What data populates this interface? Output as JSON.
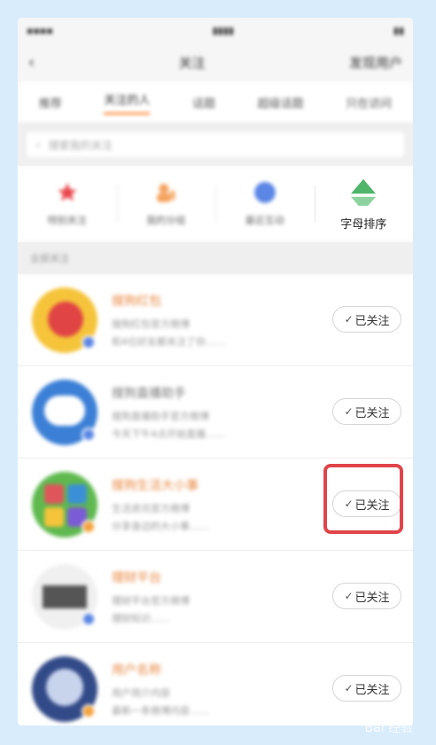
{
  "nav": {
    "title": "关注",
    "right_action": "发现用户"
  },
  "tabs": [
    "推荐",
    "关注的人",
    "话题",
    "超级话题",
    "只在访问"
  ],
  "search": {
    "placeholder": "搜索我的关注"
  },
  "filters": [
    {
      "label": "特别关注",
      "icon": "star-icon",
      "color": "#e8454b"
    },
    {
      "label": "我的分组",
      "icon": "group-icon",
      "color": "#f5a25d"
    },
    {
      "label": "最近互动",
      "icon": "compass-icon",
      "color": "#5b86e5"
    },
    {
      "label": "字母排序",
      "icon": "diamond-icon",
      "color": "#5cb85c"
    }
  ],
  "section_title": "全部关注",
  "follow_label": "已关注",
  "follow_check": "✓",
  "users": [
    {
      "name": "搜狗红包",
      "line1": "搜狗红包官方微博",
      "line2": "和4位好友都关注了你……",
      "name_color": "#e8843c",
      "avatar_color": "#f5c43a",
      "badge_color": "#5b86e5"
    },
    {
      "name": "搜狗直播助手",
      "line1": "搜狗直播助手官方微博",
      "line2": "今天下午4点开始直播……",
      "name_color": "#777777",
      "avatar_color": "#3b7fd6",
      "badge_color": "#5b86e5"
    },
    {
      "name": "搜狗生活大小事",
      "line1": "生活资讯官方微博",
      "line2": "分享身边的大小事……",
      "name_color": "#e8843c",
      "avatar_color": "#5fb94f",
      "badge_color": "#f5a23c"
    },
    {
      "name": "理财平台",
      "line1": "理财平台官方微博",
      "line2": "理财知识……",
      "name_color": "#e8843c",
      "avatar_color": "#c9c9c9",
      "badge_color": "#5b86e5"
    },
    {
      "name": "用户名称",
      "line1": "用户简介内容",
      "line2": "最新一条微博内容……",
      "name_color": "#e8843c",
      "avatar_color": "#324a88",
      "badge_color": "#f5a23c"
    }
  ],
  "watermark": "Bai 经验"
}
